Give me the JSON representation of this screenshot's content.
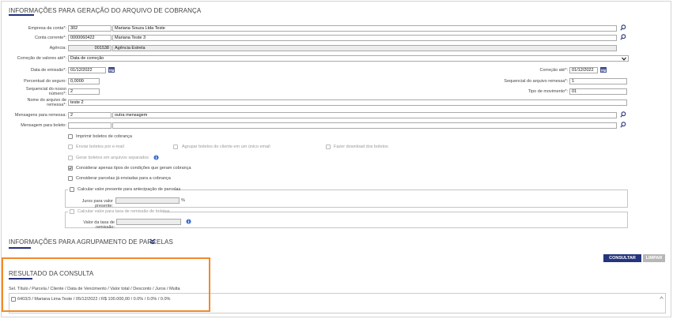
{
  "section1": {
    "title": "INFORMAÇÕES PARA GERAÇÃO DO ARQUIVO DE COBRANÇA"
  },
  "empresa": {
    "label": "Empresa da conta*:",
    "code": "302",
    "name": "Mariana Souza Ltda Teste"
  },
  "conta": {
    "label": "Conta corrente*:",
    "code": "0000060422",
    "name": "Mariana Teste 3"
  },
  "agencia": {
    "label": "Agência:",
    "code": "001538",
    "name": "Agência Estrela"
  },
  "correcao_valores": {
    "label": "Correção de valores até*:",
    "value": "Data de correção"
  },
  "data_emissao": {
    "label": "Data de emissão*:",
    "value": "01/12/2022"
  },
  "correcao_ate": {
    "label": "Correção até*:",
    "value": "01/12/2022"
  },
  "percentual_seguro": {
    "label": "Percentual do seguro:",
    "value": "0,0000"
  },
  "sequencial_remessa": {
    "label": "Sequencial do arquivo remessa*:",
    "value": "1"
  },
  "sequencial_nosso": {
    "label_line1": "Sequencial do nosso",
    "label_line2": "número*:",
    "value": "2"
  },
  "tipo_movimento": {
    "label": "Tipo de movimento*:",
    "value": "01"
  },
  "nome_arquivo": {
    "label_line1": "Nome do arquivo de",
    "label_line2": "remessa*:",
    "value": "teste 2"
  },
  "msg_remessa": {
    "label": "Mensagens para remessa:",
    "code": "2",
    "text": "outra mensagem"
  },
  "msg_boleto": {
    "label": "Mensagem para boleto:",
    "code": "",
    "text": ""
  },
  "checkboxes": {
    "imprimir": "Imprimir boletos de cobrança",
    "enviar_email": "Enviar boletos por e-mail",
    "agrupar": "Agrupar boletos do cliente em um único email",
    "download": "Fazer download dos boletos",
    "gerar_separados": "Gerar boletos em arquivos separados",
    "considerar_apenas": "Considerar apenas tipos de condições que geram cobrança",
    "considerar_parcelas": "Considerar parcelas já enviadas para a cobrança"
  },
  "antecipacao": {
    "legend": "Calcular valor presente para antecipação de parcelas",
    "label": "Juros para valor presente:",
    "value": "",
    "suffix": "%"
  },
  "remissao": {
    "legend": "Calcular valor para taxa de remissão de boletos",
    "label": "Valor da taxa de remissão:",
    "value": ""
  },
  "section2": {
    "title": "INFORMAÇÕES PARA AGRUPAMENTO DE PARCELAS"
  },
  "buttons": {
    "consultar": "CONSULTAR",
    "limpar": "LIMPAR"
  },
  "resultado": {
    "title": "RESULTADO DA CONSULTA",
    "header": "Sel. Título / Parcela / Cliente / Data de Vencimento / Valor total / Desconto / Juros / Multa",
    "rows": [
      "6403/3 / Mariana Lima Teste / 05/12/2022 / R$ 100.000,00 / 0.0% / 0.0% / 0.0%"
    ]
  },
  "colors": {
    "accent": "#23307a",
    "highlight": "#f08a2c",
    "button": "#24347e",
    "button_disabled": "#b7b7b7"
  }
}
